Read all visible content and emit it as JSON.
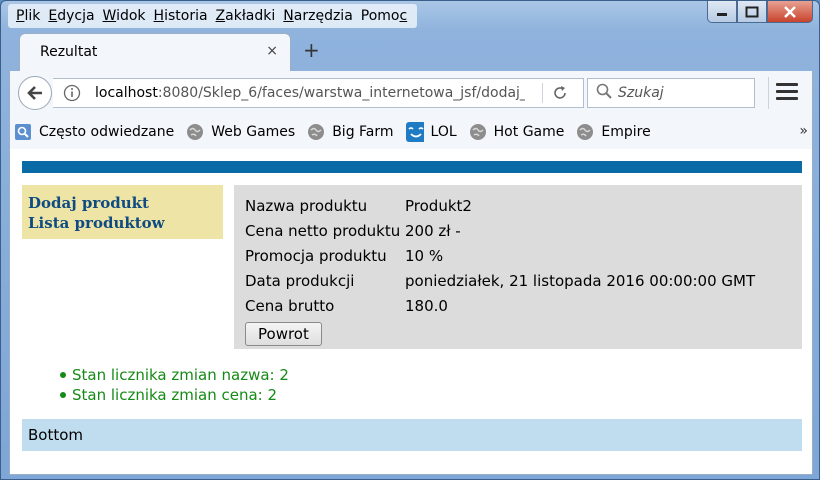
{
  "menu": {
    "items": [
      {
        "u": "P",
        "rest": "lik"
      },
      {
        "u": "E",
        "rest": "dycja"
      },
      {
        "u": "W",
        "rest": "idok"
      },
      {
        "u": "H",
        "rest": "istoria"
      },
      {
        "u": "Z",
        "rest": "akładki"
      },
      {
        "u": "N",
        "rest": "arzędzia"
      },
      {
        "pre": "Pomo",
        "u": "c"
      }
    ]
  },
  "tab": {
    "title": "Rezultat",
    "close": "×"
  },
  "new_tab": "+",
  "nav": {
    "url_host": "localhost",
    "url_rest": ":8080/Sklep_6/faces/warstwa_internetowa_jsf/dodaj_",
    "search_placeholder": "Szukaj"
  },
  "bookmarks": [
    {
      "label": "Często odwiedzane",
      "icon": "frequent-icon"
    },
    {
      "label": "Web Games",
      "icon": "globe-icon"
    },
    {
      "label": "Big Farm",
      "icon": "globe-icon"
    },
    {
      "label": "LOL",
      "icon": "lol-icon"
    },
    {
      "label": "Hot Game",
      "icon": "globe-icon"
    },
    {
      "label": "Empire",
      "icon": "globe-icon"
    }
  ],
  "bookmarks_more": "»",
  "leftnav": {
    "add": "Dodaj produkt",
    "list": "Lista produktow"
  },
  "product": {
    "rows": [
      {
        "label": "Nazwa produktu",
        "value": "Produkt2"
      },
      {
        "label": "Cena netto produktu",
        "value": "200 zł -"
      },
      {
        "label": "Promocja produktu",
        "value": "10 %"
      },
      {
        "label": "Data produkcji",
        "value": "poniedziałek, 21 listopada 2016 00:00:00 GMT"
      },
      {
        "label": "Cena brutto",
        "value": "180.0"
      }
    ],
    "button": "Powrot"
  },
  "counters": [
    "Stan licznika zmian nazwa: 2",
    "Stan licznika zmian cena: 2"
  ],
  "footer": "Bottom",
  "colors": {
    "topbar": "#0a6aa6",
    "leftnav_bg": "#ede4a6",
    "link": "#0f4b82",
    "counter": "#168a16",
    "footer_bg": "#c0ddf0"
  }
}
